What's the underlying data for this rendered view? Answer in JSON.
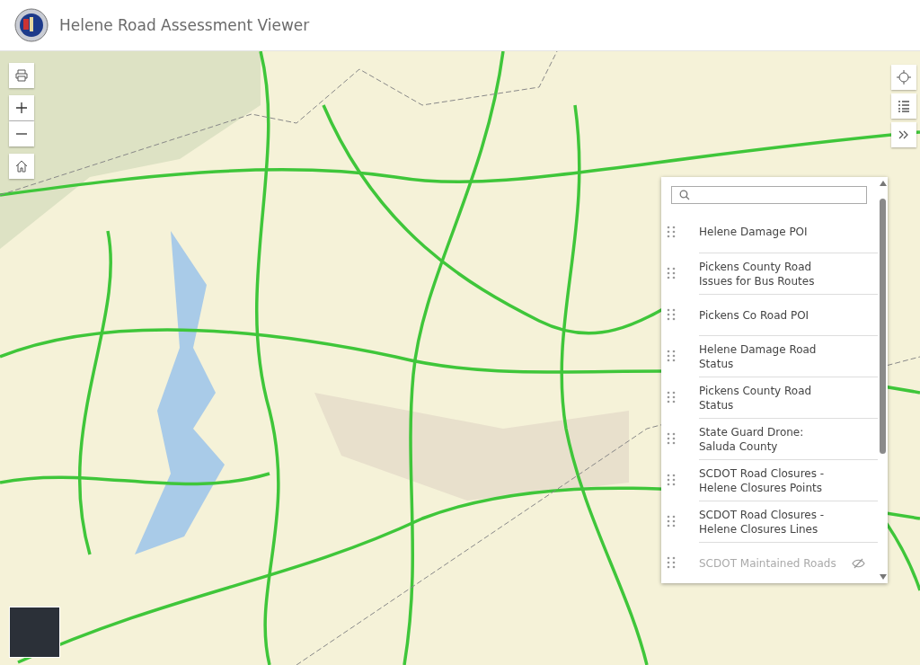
{
  "header": {
    "title": "Helene Road Assessment Viewer"
  },
  "layer_list": {
    "layers": [
      {
        "title": "Helene Damage POI",
        "visible": true
      },
      {
        "title": "Pickens County Road Issues for Bus Routes",
        "visible": true
      },
      {
        "title": "Pickens Co Road POI",
        "visible": true
      },
      {
        "title": "Helene Damage Road Status",
        "visible": true
      },
      {
        "title": "Pickens County Road Status",
        "visible": true
      },
      {
        "title": "State Guard Drone: Saluda County",
        "visible": true
      },
      {
        "title": "SCDOT Road Closures - Helene Closures Points",
        "visible": true
      },
      {
        "title": "SCDOT Road Closures - Helene Closures Lines",
        "visible": true
      },
      {
        "title": "SCDOT Maintained Roads",
        "visible": false
      }
    ]
  }
}
